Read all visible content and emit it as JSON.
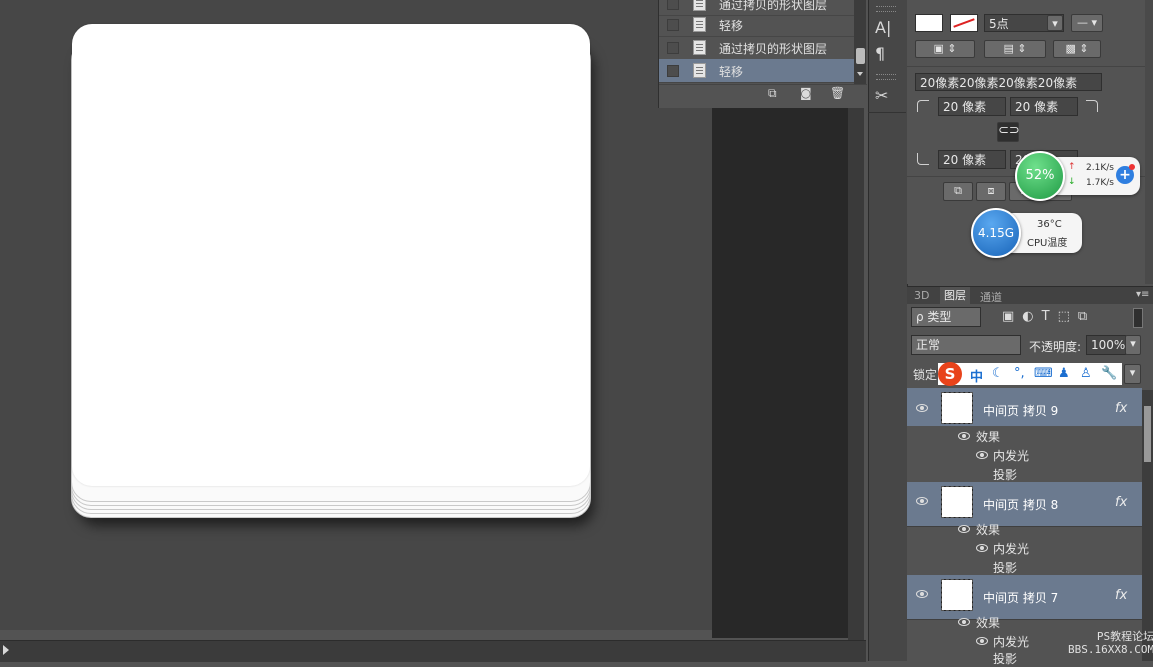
{
  "history": {
    "rows": [
      {
        "label": "通过拷贝的形状图层",
        "selected": false
      },
      {
        "label": "轻移",
        "selected": false
      },
      {
        "label": "通过拷贝的形状图层",
        "selected": false
      },
      {
        "label": "轻移",
        "selected": true
      }
    ],
    "footer_icons": [
      "new-snapshot-icon",
      "camera-icon",
      "trash-icon"
    ]
  },
  "tools": [
    "character-icon",
    "paragraph-icon",
    "tool-preset-icon"
  ],
  "properties": {
    "stroke_size": "5点",
    "radius_summary": "20像素20像素20像素20像素",
    "corner_tl": "20 像素",
    "corner_tr": "20 像素",
    "corner_bl": "20 像素",
    "corner_br": "20"
  },
  "net_widget": {
    "percent": "52%",
    "upload": "2.1K/s",
    "download": "1.7K/s"
  },
  "cpu_widget": {
    "memory": "4.15G",
    "temp": "36°C",
    "label": "CPU温度"
  },
  "layers_panel": {
    "tabs": [
      "3D",
      "图层",
      "通道"
    ],
    "active_tab": "图层",
    "filter": "ρ 类型",
    "blend_mode": "正常",
    "opacity_label": "不透明度:",
    "opacity_value": "100%",
    "lock_label": "锁定",
    "layers": [
      {
        "name": "中间页 拷贝 9",
        "fx": "fx",
        "effects_label": "效果",
        "effects": [
          "内发光",
          "投影"
        ]
      },
      {
        "name": "中间页 拷贝 8",
        "fx": "fx",
        "effects_label": "效果",
        "effects": [
          "内发光",
          "投影"
        ]
      },
      {
        "name": "中间页 拷贝 7",
        "fx": "fx",
        "effects_label": "效果",
        "effects": [
          "内发光",
          "投影"
        ]
      }
    ]
  },
  "ime_bar": {
    "logo": "S",
    "mode": "中",
    "icons": [
      "moon-icon",
      "punctuation-icon",
      "keyboard-icon",
      "user-icon",
      "shirt-icon",
      "wrench-icon"
    ]
  },
  "watermark": {
    "line1": "PS教程论坛",
    "line2": "BBS.16XX8.COM"
  }
}
